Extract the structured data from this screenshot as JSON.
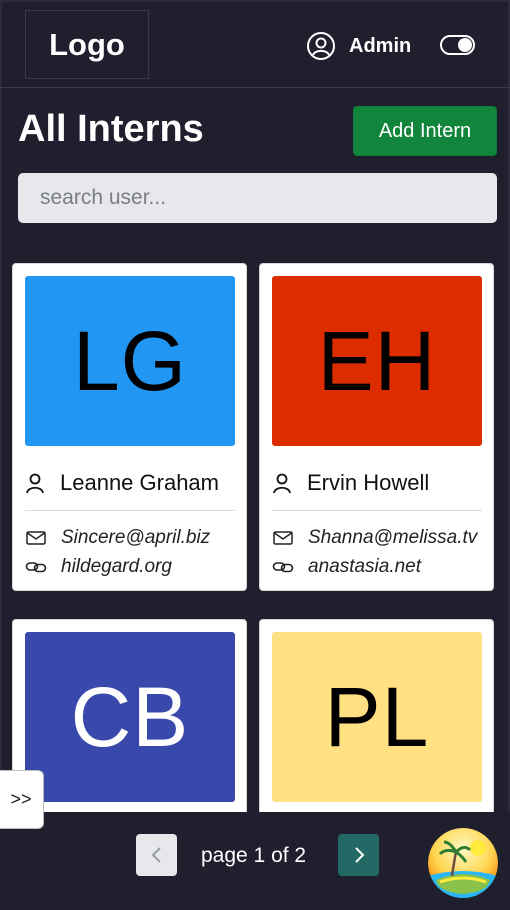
{
  "header": {
    "logo": "Logo",
    "user_name": "Admin",
    "icons": {
      "user": "user-circle-icon",
      "toggle": "theme-toggle"
    }
  },
  "main": {
    "title": "All Interns",
    "add_button": "Add Intern",
    "search_placeholder": "search user..."
  },
  "interns": [
    {
      "initials": "LG",
      "name": "Leanne Graham",
      "email": "Sincere@april.biz",
      "website": "hildegard.org",
      "color": "#2196f3",
      "text_color": "#000000"
    },
    {
      "initials": "EH",
      "name": "Ervin Howell",
      "email": "Shanna@melissa.tv",
      "website": "anastasia.net",
      "color": "#dd2c00",
      "text_color": "#000000"
    },
    {
      "initials": "CB",
      "color": "#3949ab",
      "text_color": "#ffffff"
    },
    {
      "initials": "PL",
      "color": "#ffe082",
      "text_color": "#000000"
    }
  ],
  "pagination": {
    "label": "page 1 of 2",
    "prev_icon": "chevron-left-icon",
    "next_icon": "chevron-right-icon"
  },
  "sidebar_toggle": ">>"
}
